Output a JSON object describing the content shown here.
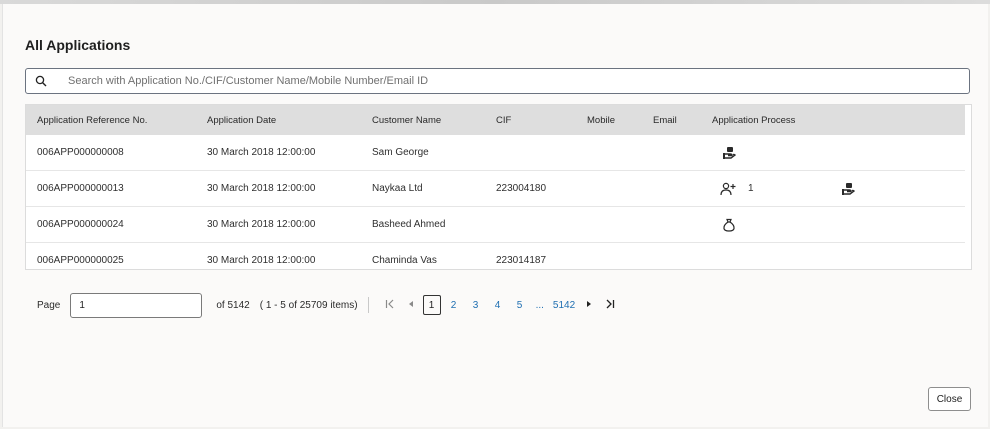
{
  "dialog": {
    "title": "All Applications",
    "search_placeholder": "Search with Application No./CIF/Customer Name/Mobile Number/Email ID",
    "search_value": ""
  },
  "table": {
    "columns": [
      "Application Reference No.",
      "Application Date",
      "Customer Name",
      "CIF",
      "Mobile",
      "Email",
      "Application Process"
    ],
    "rows": [
      {
        "ref": "006APP000000008",
        "date": "30 March 2018 12:00:00",
        "customer": "Sam George",
        "cif": "",
        "mobile": "",
        "email": "",
        "process_count": ""
      },
      {
        "ref": "006APP000000013",
        "date": "30 March 2018 12:00:00",
        "customer": "Naykaa Ltd",
        "cif": "223004180",
        "mobile": "",
        "email": "",
        "process_count": "1"
      },
      {
        "ref": "006APP000000024",
        "date": "30 March 2018 12:00:00",
        "customer": "Basheed Ahmed",
        "cif": "",
        "mobile": "",
        "email": "",
        "process_count": ""
      },
      {
        "ref": "006APP000000025",
        "date": "30 March 2018 12:00:00",
        "customer": "Chaminda Vas",
        "cif": "223014187",
        "mobile": "",
        "email": "",
        "process_count": ""
      }
    ]
  },
  "pager": {
    "page_label": "Page",
    "page_value": "1",
    "of_text": "of 5142",
    "range_text": "( 1 - 5 of 25709 items)",
    "pages": [
      "1",
      "2",
      "3",
      "4",
      "5"
    ],
    "ellipsis": "...",
    "last_page": "5142"
  },
  "footer": {
    "close_label": "Close"
  },
  "icons": {
    "search": "search-icon",
    "process_handover": "hand-money-icon",
    "process_user": "user-add-icon",
    "process_bag": "money-bag-icon",
    "first": "first-page-icon",
    "prev": "prev-page-icon",
    "next": "next-page-icon",
    "last": "last-page-icon"
  },
  "colors": {
    "link": "#1f6fb2",
    "header_bg": "#dedede",
    "page_bg": "#fbfaf9"
  }
}
